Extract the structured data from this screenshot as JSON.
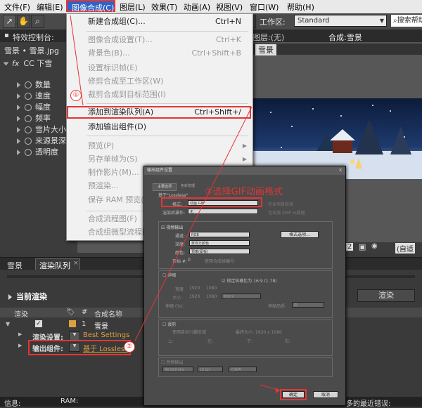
{
  "menubar": {
    "items": [
      "文件(F)",
      "编辑(E)",
      "图像合成(C)",
      "图层(L)",
      "效果(T)",
      "动画(A)",
      "视图(V)",
      "窗口(W)",
      "帮助(H)"
    ]
  },
  "toolbar": {
    "workspace_label": "工作区:",
    "workspace_value": "Standard",
    "search_placeholder": "搜索帮助"
  },
  "effects_panel": {
    "tab_label": "特效控制台:",
    "layer_path": "雪景 • 雪景.jpg",
    "effect_name": "CC 下雪",
    "properties": [
      "数量",
      "速度",
      "幅度",
      "频率",
      "雪片大小",
      "来源景深",
      "透明度"
    ]
  },
  "composition_panel": {
    "layer_tab": "图层:(无)",
    "comp_tab": "合成:雪景",
    "comp_sub_tab": "雪景",
    "zoom_value": "2",
    "resolution_value": "(自适"
  },
  "dropdown_menu": {
    "items": [
      {
        "label": "新建合成组(C)...",
        "shortcut": "Ctrl+N",
        "disabled": false
      },
      {
        "label": "图像合成设置(T)...",
        "shortcut": "Ctrl+K",
        "disabled": true
      },
      {
        "label": "背景色(B)...",
        "shortcut": "Ctrl+Shift+B",
        "disabled": true
      },
      {
        "label": "设置标识帧(E)",
        "shortcut": "",
        "disabled": true
      },
      {
        "label": "修剪合成至工作区(W)",
        "shortcut": "",
        "disabled": true
      },
      {
        "label": "裁剪合成到目标范围(I)",
        "shortcut": "",
        "disabled": true
      },
      {
        "label": "添加到渲染队列(A)",
        "shortcut": "Ctrl+Shift+/",
        "disabled": false
      },
      {
        "label": "添加输出组件(D)",
        "shortcut": "",
        "disabled": false
      },
      {
        "label": "预览(P)",
        "shortcut": "",
        "disabled": true
      },
      {
        "label": "另存单帧为(S)",
        "shortcut": "",
        "disabled": true
      },
      {
        "label": "制作影片(M)...",
        "shortcut": "",
        "disabled": true
      },
      {
        "label": "预渲染...",
        "shortcut": "",
        "disabled": true
      },
      {
        "label": "保存 RAM 预览(",
        "shortcut": "",
        "disabled": true
      },
      {
        "label": "合成流程图(F)",
        "shortcut": "",
        "disabled": true
      },
      {
        "label": "合成组微型流程图",
        "shortcut": "",
        "disabled": true
      }
    ]
  },
  "bottom_panel": {
    "tabs": [
      "雪景",
      "渲染队列"
    ],
    "current_render_label": "当前渲染",
    "render_button": "渲染",
    "columns": [
      "渲染",
      "#",
      "合成名称"
    ],
    "row_number": "1",
    "row_comp_name": "雪景",
    "render_settings_label": "渲染设置:",
    "render_settings_value": "Best Settings",
    "output_module_label": "输出组件:",
    "output_module_value": "基于 Lossless"
  },
  "status_bar": {
    "info_label": "信息:",
    "ram_label": "RAM:",
    "recent_errors": "多的最近错误:"
  },
  "dialog": {
    "title": "输出组件设置",
    "tabs": [
      "主要选项",
      "色彩管理"
    ],
    "based_on": "基于\"Lossless\"",
    "format_label": "格式:",
    "format_value": "动画 GIF",
    "include_project_link": "包含项目链接",
    "post_render_label": "渲染后操作:",
    "post_render_value": "无",
    "include_xmp": "包含源 XMP 元数据",
    "video_output_label": "视频输出",
    "channels_label": "通道:",
    "channels_value": "RGB",
    "format_options_button": "格式选项...",
    "depth_label": "深度:",
    "depth_value": "数百万颜色",
    "color_label": "颜色:",
    "color_value": "预乘(蒙板)",
    "start_label": "开始 #:",
    "start_value": "0",
    "use_comp_frame": "使用合成帧编号",
    "stretch_label": "伸缩",
    "lock_aspect": "锁定纵横比为 16:9 (1.78)",
    "width_label": "宽度",
    "width_value": "1920",
    "height_value": "1080",
    "size_label": "大小:",
    "size_w": "1920",
    "size_h": "1080",
    "custom_value": "自定义",
    "stretch_pct_label": "伸缩 (%):",
    "quality_label": "伸缩品质:",
    "quality_value": "高",
    "crop_label": "裁剪",
    "roi_label": "使用目标兴趣区域",
    "final_size": "最终大小: 1920 x 1080",
    "top_label": "上:",
    "left_label": "左:",
    "bottom_label": "下:",
    "right_label": "右:",
    "audio_output_label": "音频输出",
    "audio_rate": "48.000 kHz",
    "audio_bits": "16 bit",
    "audio_channels": "立体声",
    "ok_button": "确定",
    "cancel_button": "取消"
  },
  "annotations": {
    "step1": "①",
    "step2": "②",
    "step3_text": "③选择GIF动画格式",
    "accent_color": "#e23636"
  }
}
